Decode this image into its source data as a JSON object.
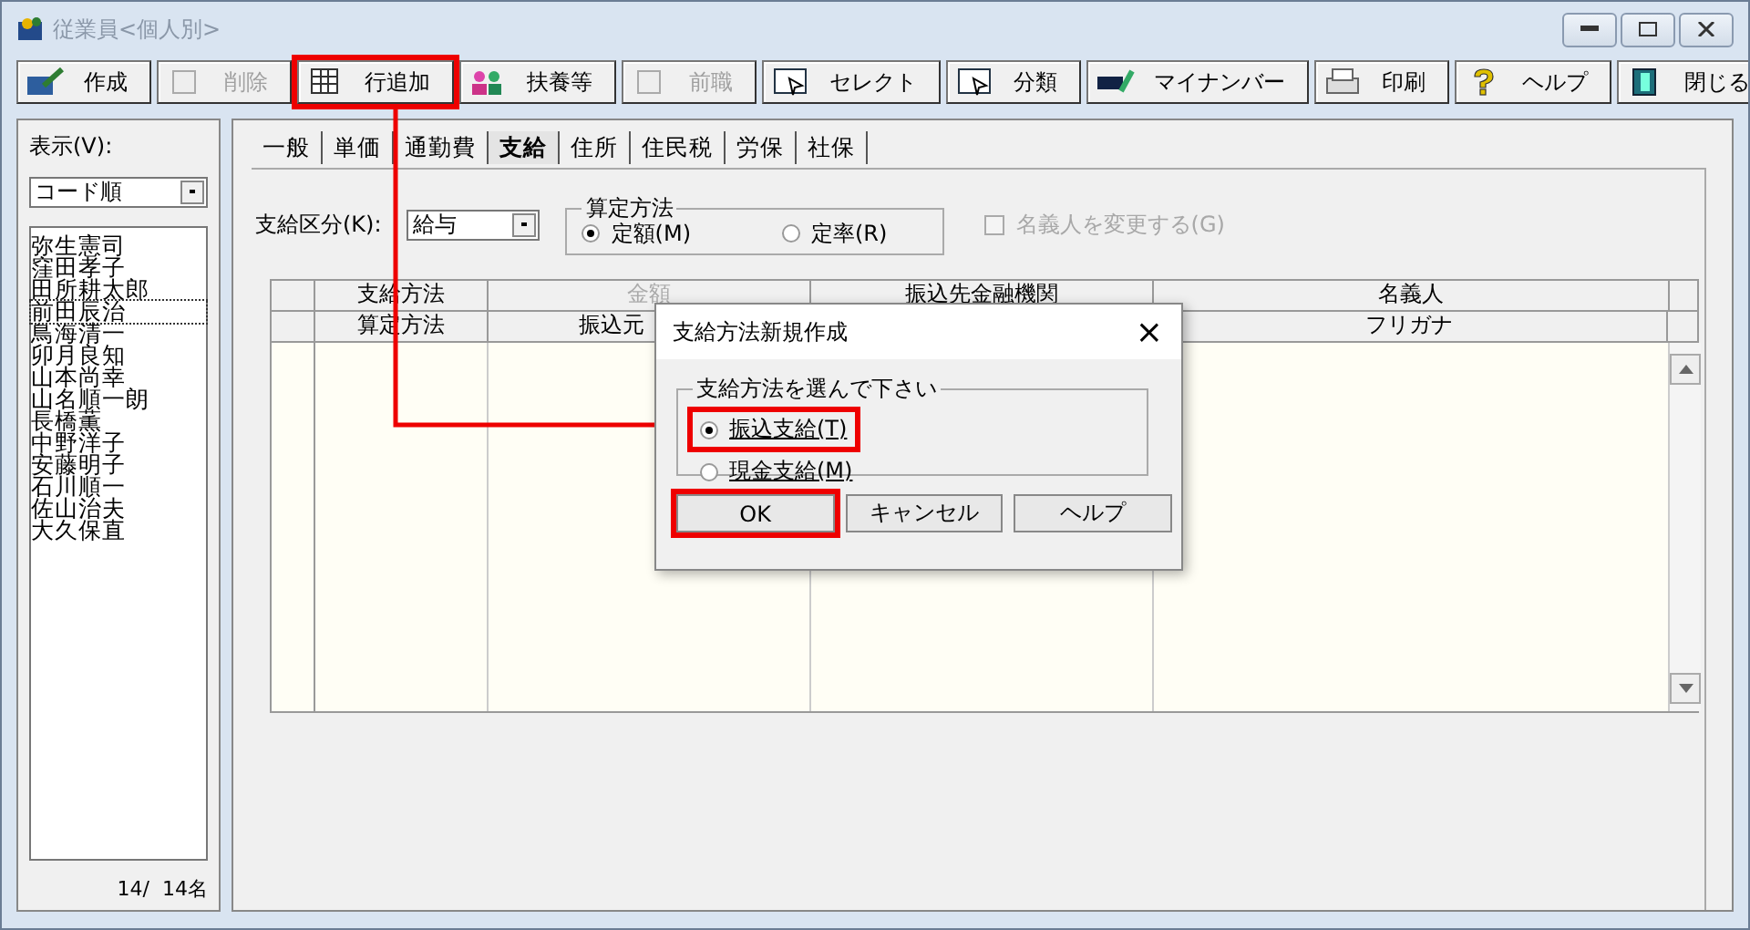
{
  "window": {
    "title": "従業員<個人別>"
  },
  "toolbar": [
    {
      "label": "作成",
      "disabled": false,
      "highlighted": false
    },
    {
      "label": "削除",
      "disabled": true,
      "highlighted": false
    },
    {
      "label": "行追加",
      "disabled": false,
      "highlighted": true
    },
    {
      "label": "扶養等",
      "disabled": false,
      "highlighted": false
    },
    {
      "label": "前職",
      "disabled": true,
      "highlighted": false
    },
    {
      "label": "セレクト",
      "disabled": false,
      "highlighted": false
    },
    {
      "label": "分類",
      "disabled": false,
      "highlighted": false
    },
    {
      "label": "マイナンバー",
      "disabled": false,
      "highlighted": false
    },
    {
      "label": "印刷",
      "disabled": false,
      "highlighted": false
    },
    {
      "label": "ヘルプ",
      "disabled": false,
      "highlighted": false
    },
    {
      "label": "閉じる",
      "disabled": false,
      "highlighted": false
    }
  ],
  "sidebar": {
    "label": "表示(V):",
    "sort": "コード順",
    "employees": [
      {
        "name": "弥生憲司",
        "selected": false
      },
      {
        "name": "窪田孝子",
        "selected": false
      },
      {
        "name": "田所耕太郎",
        "selected": false
      },
      {
        "name": "前田辰治",
        "selected": true
      },
      {
        "name": "鳥海清一",
        "selected": false
      },
      {
        "name": "卯月良知",
        "selected": false
      },
      {
        "name": "山本尚幸",
        "selected": false
      },
      {
        "name": "山名順一朗",
        "selected": false
      },
      {
        "name": "長橋薫",
        "selected": false
      },
      {
        "name": "中野洋子",
        "selected": false
      },
      {
        "name": "安藤明子",
        "selected": false
      },
      {
        "name": "石川順一",
        "selected": false
      },
      {
        "name": "佐山治夫",
        "selected": false
      },
      {
        "name": "大久保直",
        "selected": false
      }
    ],
    "count": "14/  14名"
  },
  "tabs": [
    {
      "label": "一般",
      "selected": false
    },
    {
      "label": "単価",
      "selected": false
    },
    {
      "label": "通勤費",
      "selected": false
    },
    {
      "label": "支給",
      "selected": true
    },
    {
      "label": "住所",
      "selected": false
    },
    {
      "label": "住民税",
      "selected": false
    },
    {
      "label": "労保",
      "selected": false
    },
    {
      "label": "社保",
      "selected": false
    }
  ],
  "payment_type": {
    "label": "支給区分(K):",
    "value": "給与"
  },
  "calc_method": {
    "title": "算定方法",
    "options": [
      {
        "label": "定額(M)",
        "selected": true
      },
      {
        "label": "定率(R)",
        "selected": false
      }
    ]
  },
  "change_holder": {
    "label": "名義人を変更する(G)",
    "checked": false,
    "disabled": true
  },
  "table": {
    "header_row_1": [
      {
        "label": "支給方法",
        "disabled": false
      },
      {
        "label": "金額",
        "disabled": true
      },
      {
        "label": "振込先金融機関",
        "disabled": false
      },
      {
        "label": "名義人",
        "disabled": false
      }
    ],
    "header_row_2": {
      "column_1": "算定方法",
      "column_2": "振込元",
      "column_4": "フリガナ"
    }
  },
  "dialog": {
    "title": "支給方法新規作成",
    "close": "×",
    "group": "支給方法を選んで下さい",
    "options": [
      {
        "label": "振込支給(T)",
        "selected": true,
        "highlighted": true
      },
      {
        "label": "現金支給(M)",
        "selected": false,
        "highlighted": false
      }
    ],
    "buttons": [
      {
        "label": "OK",
        "highlighted": true
      },
      {
        "label": "キャンセル",
        "highlighted": false
      },
      {
        "label": "ヘルプ",
        "highlighted": false
      }
    ]
  }
}
